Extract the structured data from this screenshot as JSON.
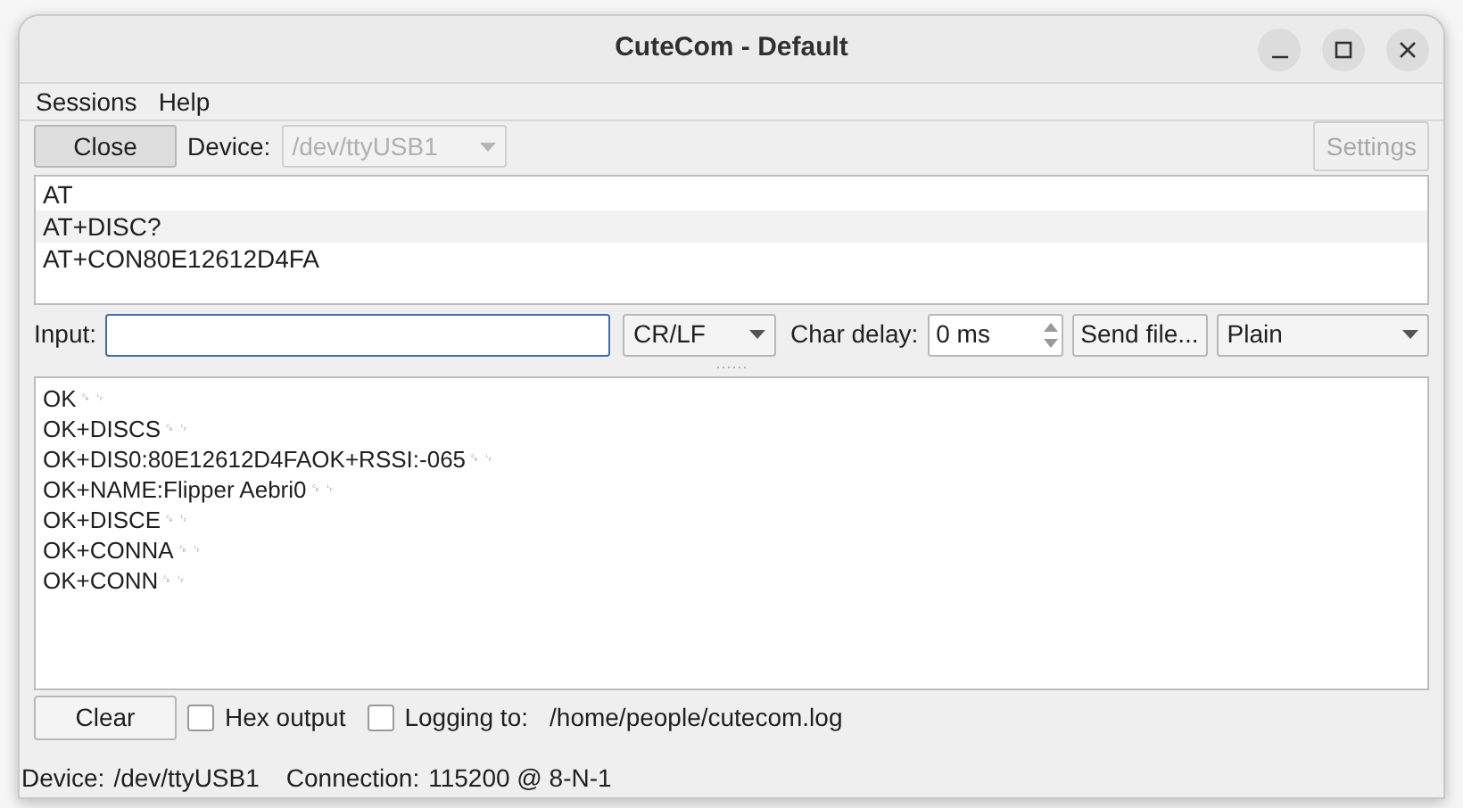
{
  "window": {
    "title": "CuteCom - Default"
  },
  "menu": [
    "Sessions",
    "Help"
  ],
  "toolbar": {
    "close_button": "Close",
    "device_label": "Device:",
    "device": {
      "value": "/dev/ttyUSB1",
      "disabled": true
    },
    "settings_button": {
      "label": "Settings",
      "disabled": true
    }
  },
  "history": [
    {
      "text": "AT",
      "selected": false
    },
    {
      "text": "AT+DISC?",
      "selected": true
    },
    {
      "text": "AT+CON80E12612D4FA",
      "selected": false
    }
  ],
  "input_row": {
    "input_label": "Input:",
    "line_ending": "CR/LF",
    "char_delay_label": "Char delay:",
    "char_delay": "0 ms",
    "send_file_button": "Send file...",
    "mode": "Plain"
  },
  "output": [
    {
      "text": "OK",
      "line_end": "␍␊"
    },
    {
      "text": "OK+DISCS",
      "line_end": "␍␊"
    },
    {
      "text": "OK+DIS0:80E12612D4FAOK+RSSI:-065",
      "line_end": "␍␊"
    },
    {
      "text": "OK+NAME:Flipper Aebri0",
      "line_end": "␍␊"
    },
    {
      "text": "OK+DISCE",
      "line_end": "␍␊"
    },
    {
      "text": "OK+CONNA",
      "line_end": "␍␊"
    },
    {
      "text": "OK+CONN",
      "line_end": "␍␊"
    }
  ],
  "bottom": {
    "clear_button": "Clear",
    "hex_output": {
      "label": "Hex output",
      "checked": false
    },
    "logging": {
      "label": "Logging to:",
      "checked": false
    },
    "log_path": "/home/people/cutecom.log"
  },
  "status_bar": {
    "device_label": "Device:",
    "device": "/dev/ttyUSB1",
    "connection_label": "Connection:",
    "connection": "115200 @ 8-N-1"
  }
}
